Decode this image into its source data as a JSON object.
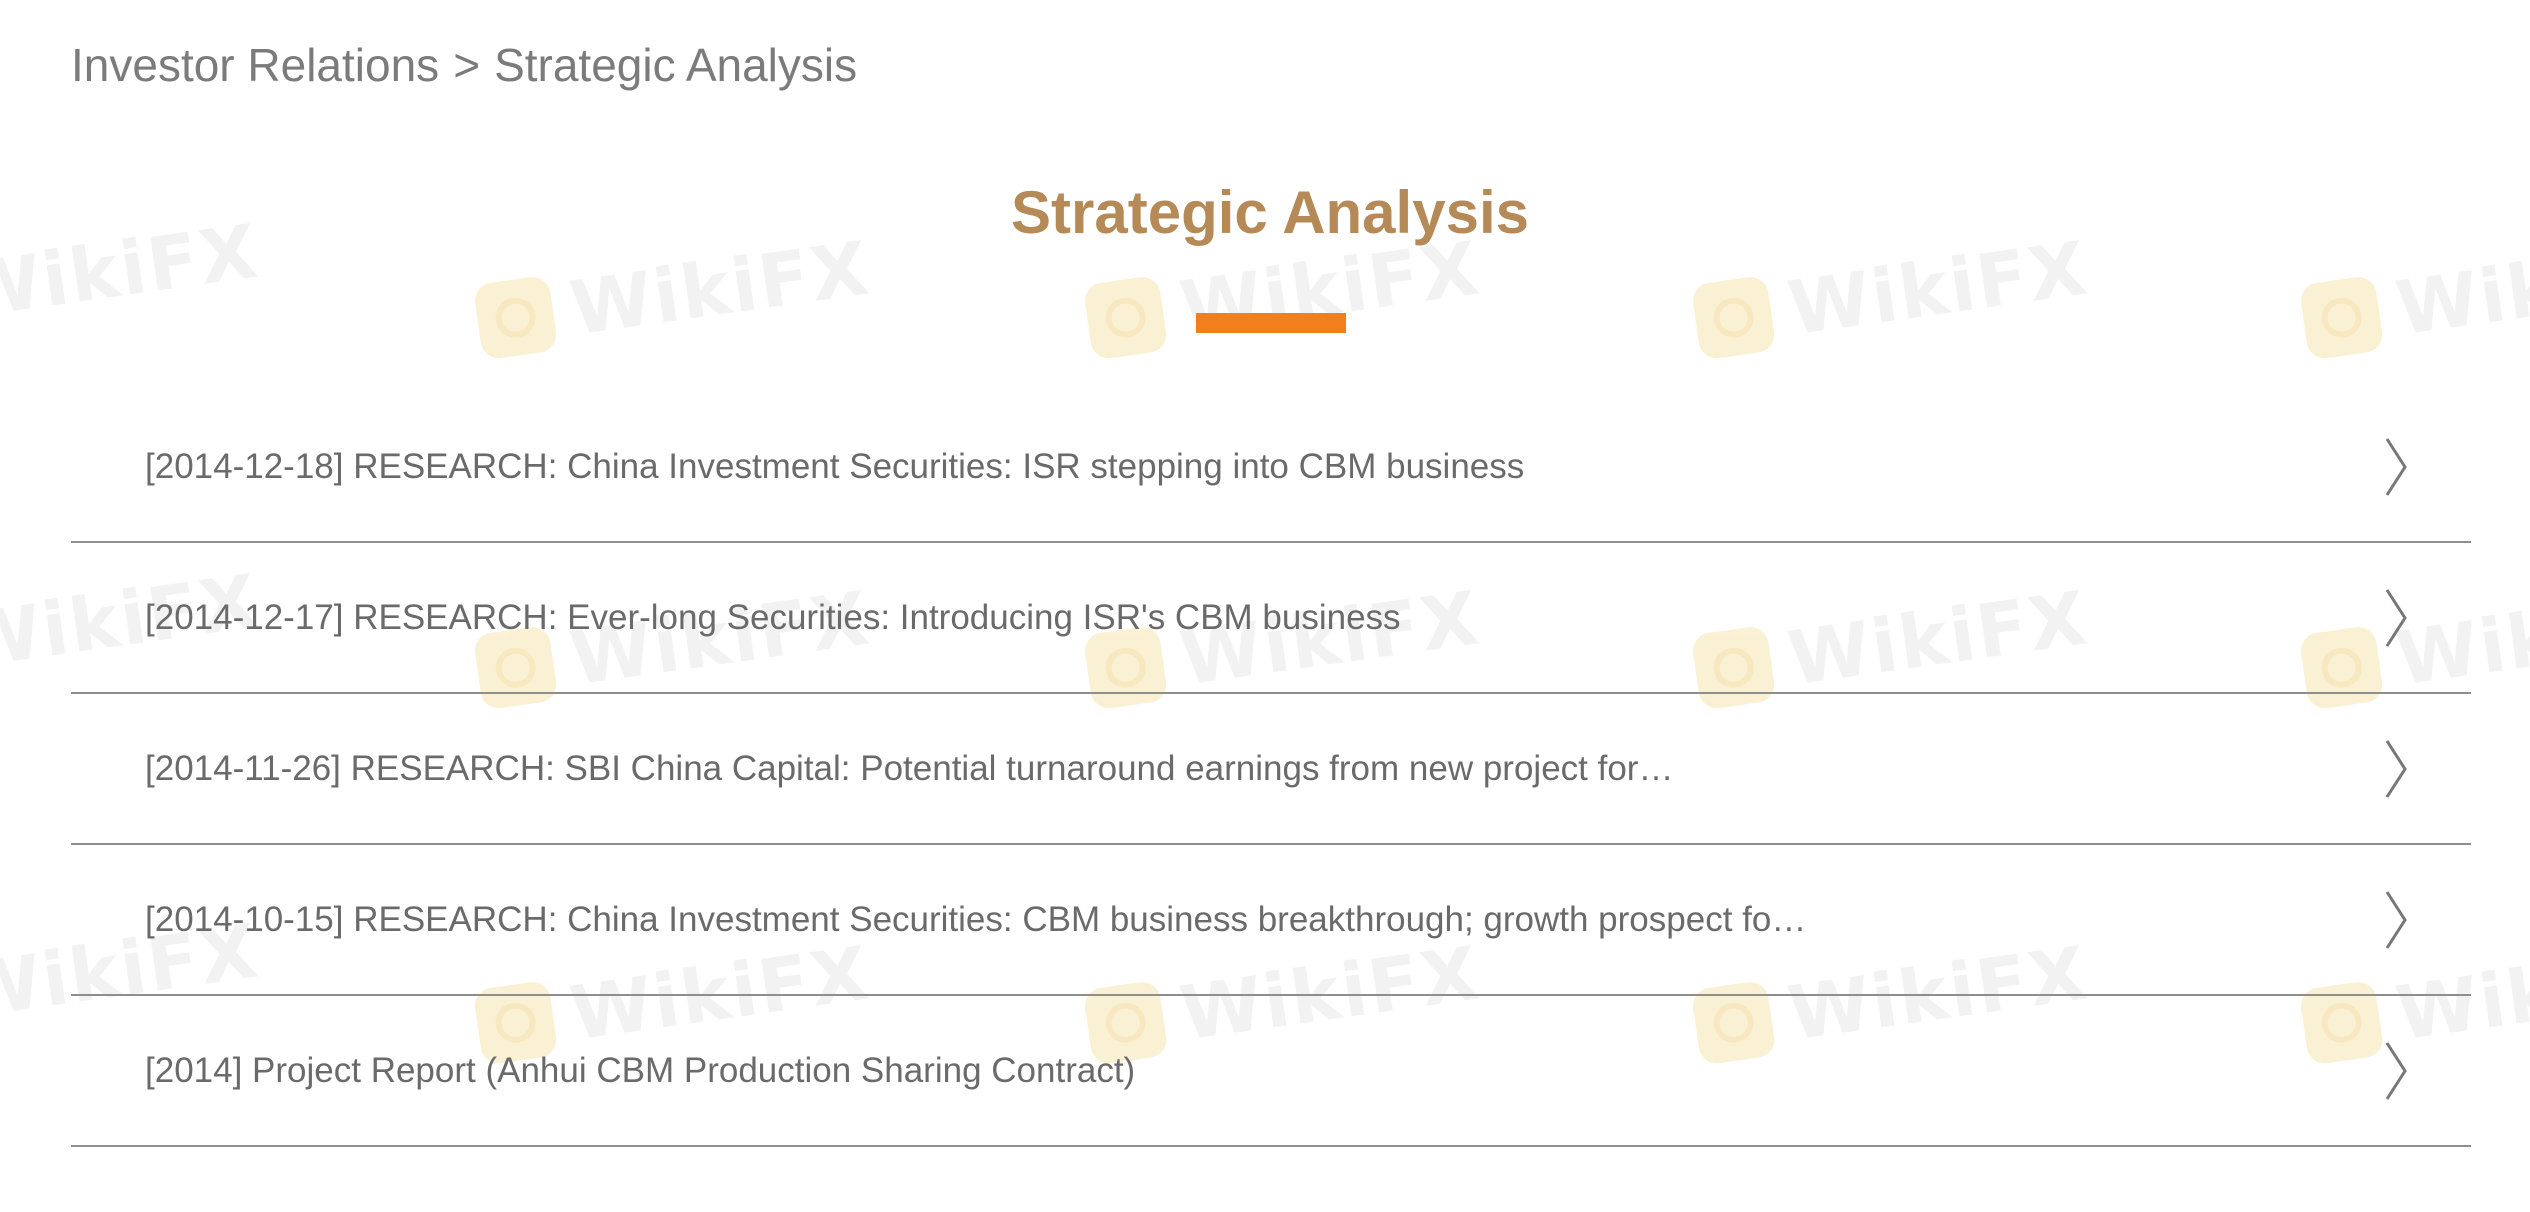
{
  "breadcrumb": {
    "parent": "Investor Relations",
    "separator": ">",
    "current": "Strategic Analysis"
  },
  "page": {
    "title": "Strategic Analysis"
  },
  "articles": [
    {
      "label": "[2014-12-18] RESEARCH: China Investment Securities: ISR stepping into CBM business"
    },
    {
      "label": "[2014-12-17] RESEARCH: Ever-long Securities: Introducing ISR's CBM business"
    },
    {
      "label": "[2014-11-26] RESEARCH: SBI China Capital: Potential turnaround earnings from new project for…"
    },
    {
      "label": "[2014-10-15] RESEARCH: China Investment Securities: CBM business breakthrough; growth prospect fo…"
    },
    {
      "label": "[2014] Project Report (Anhui CBM Production Sharing Contract)"
    }
  ],
  "watermark": {
    "text": "WikiFX"
  },
  "colors": {
    "title": "#b58a57",
    "accent": "#f27f1b",
    "text": "#6a6a6a",
    "divider": "#8e8e8e"
  },
  "icons": {
    "row_arrow": "chevron-right-icon",
    "watermark_logo": "wikifx-logo-icon"
  }
}
